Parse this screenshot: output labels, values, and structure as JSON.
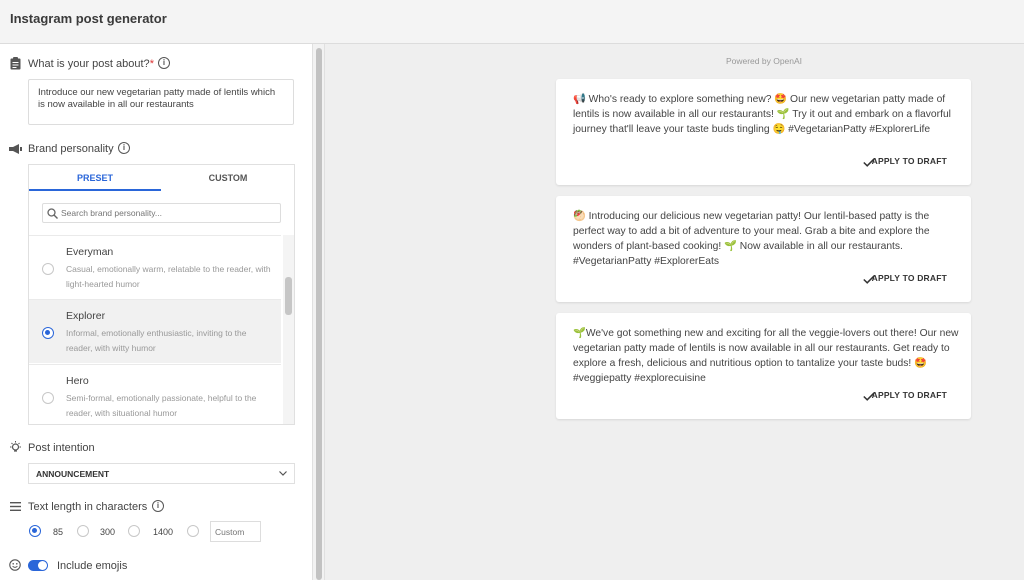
{
  "app": {
    "title": "Instagram post generator"
  },
  "topic": {
    "label": "What is your post about?",
    "required_mark": "*",
    "value": "Introduce our new vegetarian patty made of lentils which is now available in all our restaurants"
  },
  "brand": {
    "label": "Brand personality",
    "tabs": [
      {
        "label": "PRESET",
        "active": true
      },
      {
        "label": "CUSTOM",
        "active": false
      }
    ],
    "search_placeholder": "Search brand personality...",
    "personalities": [
      {
        "name": "Everyman",
        "description": "Casual, emotionally warm, relatable to the reader, with light-hearted humor",
        "selected": false
      },
      {
        "name": "Explorer",
        "description": "Informal, emotionally enthusiastic, inviting to the reader, with witty humor",
        "selected": true
      },
      {
        "name": "Hero",
        "description": "Semi-formal, emotionally passionate, helpful to the reader, with situational humor",
        "selected": false
      }
    ]
  },
  "intention": {
    "label": "Post intention",
    "value": "ANNOUNCEMENT"
  },
  "length": {
    "label": "Text length in characters",
    "options": [
      {
        "label": "85",
        "selected": true
      },
      {
        "label": "300",
        "selected": false
      },
      {
        "label": "1400",
        "selected": false
      }
    ],
    "custom_placeholder": "Custom"
  },
  "emojis": {
    "label": "Include emojis",
    "enabled": true
  },
  "output": {
    "powered_by": "Powered by OpenAI",
    "apply_label": "APPLY TO DRAFT",
    "posts": [
      "📢 Who's ready to explore something new? 🤩 Our new vegetarian patty made of lentils is now available in all our restaurants! 🌱 Try it out and embark on a flavorful journey that'll leave your taste buds tingling 🤤 #VegetarianPatty #ExplorerLife",
      "🥙 Introducing our delicious new vegetarian patty! Our lentil-based patty is the perfect way to add a bit of adventure to your meal. Grab a bite and explore the wonders of plant-based cooking! 🌱 Now available in all our restaurants. #VegetarianPatty #ExplorerEats",
      "🌱We've got something new and exciting for all the veggie-lovers out there! Our new vegetarian patty made of lentils is now available in all our restaurants. Get ready to explore a fresh, delicious and nutritious option to tantalize your taste buds! 🤩 #veggiepatty #explorecuisine"
    ]
  },
  "colors": {
    "accent": "#2a66d9",
    "required": "#dd3333"
  }
}
